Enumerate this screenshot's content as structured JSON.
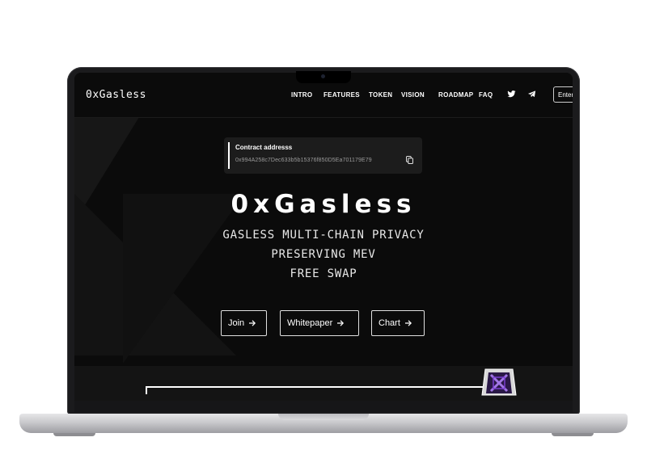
{
  "brand": {
    "logo_text": "0xGasless"
  },
  "nav": {
    "items": [
      "INTRO",
      "FEATURES",
      "TOKEN",
      "VISION",
      "ROADMAP",
      "FAQ"
    ],
    "enter_label": "Enter"
  },
  "contract": {
    "label": "Contract addresss",
    "address": "0x994A258c7Dec633b5b15376f850D5Ea701179E79"
  },
  "hero": {
    "title": "0xGasless",
    "subtitle_lines": [
      "GASLESS MULTI-CHAIN PRIVACY",
      "PRESERVING MEV",
      "FREE SWAP"
    ]
  },
  "buttons": {
    "join": "Join",
    "whitepaper": "Whitepaper",
    "chart": "Chart"
  },
  "icons": {
    "twitter": "twitter-icon",
    "telegram": "telegram-icon",
    "copy": "copy-icon",
    "arrow": "arrow-right-icon"
  },
  "colors": {
    "background": "#0b0b0b",
    "text": "#ffffff",
    "accent": "#7a3fd1",
    "muted": "#9a9a9a"
  }
}
